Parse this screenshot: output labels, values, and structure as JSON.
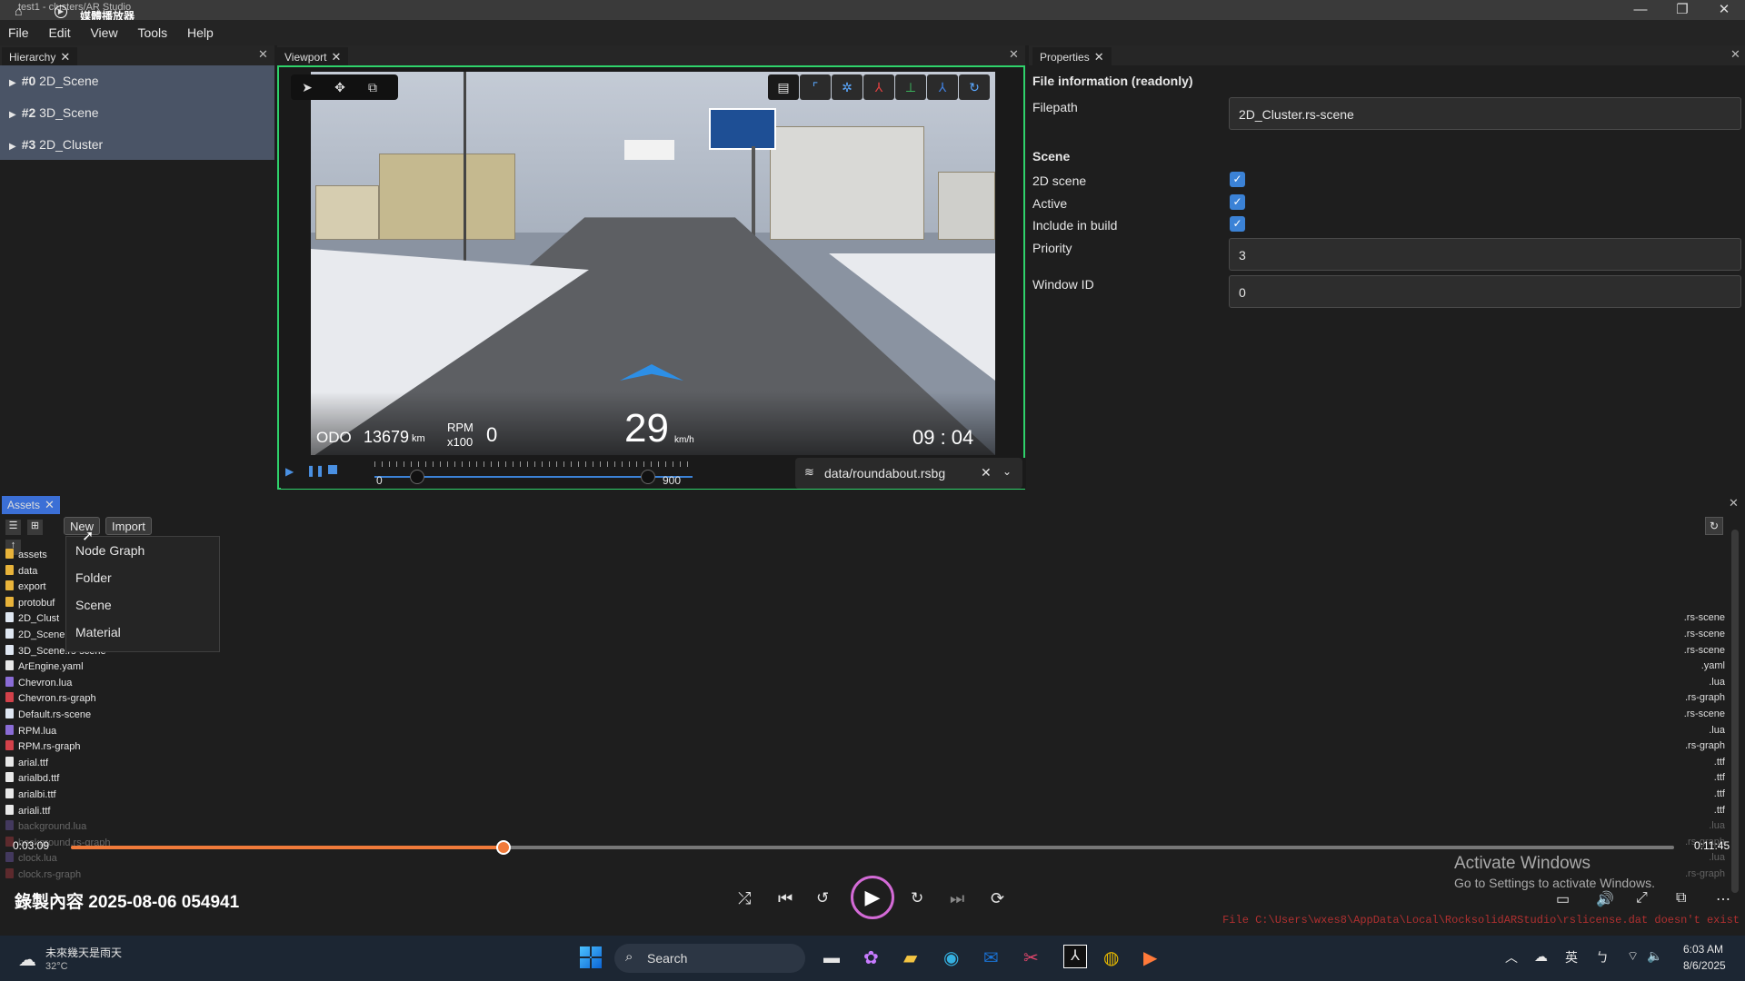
{
  "titlebar": {
    "app_title": "test1 - clusters/AR Studio",
    "overlay_title": "媒體播放器",
    "minimize": "—",
    "restore": "❐",
    "close": "✕"
  },
  "menu": [
    "File",
    "Edit",
    "View",
    "Tools",
    "Help"
  ],
  "hierarchy": {
    "tab": "Hierarchy",
    "items": [
      {
        "id": "#0",
        "name": "2D_Scene"
      },
      {
        "id": "#2",
        "name": "3D_Scene"
      },
      {
        "id": "#3",
        "name": "2D_Cluster"
      }
    ]
  },
  "viewport": {
    "tab": "Viewport",
    "odo_label": "ODO",
    "odo_value": "13679",
    "odo_unit": "km",
    "rpm_label": "RPM",
    "rpm_scale": "x100",
    "rpm_value": "0",
    "speed": "29",
    "speed_unit": "km/h",
    "clock": "09 : 04",
    "timeline_start": "0",
    "timeline_end": "900",
    "file": "data/roundabout.rsbg",
    "timeline_progress": 0.02
  },
  "properties": {
    "tab": "Properties",
    "section_file": "File information (readonly)",
    "filepath_label": "Filepath",
    "filepath_value": "2D_Cluster.rs-scene",
    "section_scene": "Scene",
    "scene2d_label": "2D scene",
    "active_label": "Active",
    "build_label": "Include in build",
    "priority_label": "Priority",
    "priority_value": "3",
    "window_label": "Window ID",
    "window_value": "0"
  },
  "assets": {
    "tab": "Assets",
    "new_btn": "New",
    "import_btn": "Import",
    "menu": [
      "Node Graph",
      "Folder",
      "Scene",
      "Material"
    ],
    "files": [
      {
        "name": "assets",
        "ext": "",
        "kind": "folder"
      },
      {
        "name": "data",
        "ext": "",
        "kind": "folder"
      },
      {
        "name": "export",
        "ext": "",
        "kind": "folder"
      },
      {
        "name": "protobuf",
        "ext": "",
        "kind": "folder"
      },
      {
        "name": "2D_Clust",
        "ext": ".rs-scene",
        "kind": "scene"
      },
      {
        "name": "2D_Scene",
        "ext": ".rs-scene",
        "kind": "scene"
      },
      {
        "name": "3D_Scene.rs-scene",
        "ext": ".rs-scene",
        "kind": "scene"
      },
      {
        "name": "ArEngine.yaml",
        "ext": ".yaml",
        "kind": "file"
      },
      {
        "name": "Chevron.lua",
        "ext": ".lua",
        "kind": "lua"
      },
      {
        "name": "Chevron.rs-graph",
        "ext": ".rs-graph",
        "kind": "graph"
      },
      {
        "name": "Default.rs-scene",
        "ext": ".rs-scene",
        "kind": "scene"
      },
      {
        "name": "RPM.lua",
        "ext": ".lua",
        "kind": "lua"
      },
      {
        "name": "RPM.rs-graph",
        "ext": ".rs-graph",
        "kind": "graph"
      },
      {
        "name": "arial.ttf",
        "ext": ".ttf",
        "kind": "file"
      },
      {
        "name": "arialbd.ttf",
        "ext": ".ttf",
        "kind": "file"
      },
      {
        "name": "arialbi.ttf",
        "ext": ".ttf",
        "kind": "file"
      },
      {
        "name": "ariali.ttf",
        "ext": ".ttf",
        "kind": "file"
      },
      {
        "name": "background.lua",
        "ext": ".lua",
        "kind": "lua"
      },
      {
        "name": "background.rs-graph",
        "ext": ".rs-graph",
        "kind": "graph"
      },
      {
        "name": "clock.lua",
        "ext": ".lua",
        "kind": "lua"
      },
      {
        "name": "clock.rs-graph",
        "ext": ".rs-graph",
        "kind": "graph"
      }
    ]
  },
  "player": {
    "elapsed": "0:03:09",
    "total": "0:11:45",
    "progress": 0.27,
    "recording_title": "錄製內容 2025-08-06 054941",
    "activate_title": "Activate Windows",
    "activate_sub": "Go to Settings to activate Windows.",
    "license_msg": "File C:\\Users\\wxes8\\AppData\\Local\\RocksolidARStudio\\rslicense.dat doesn't exist"
  },
  "taskbar": {
    "weather_text": "未來幾天是雨天",
    "temp": "32°C",
    "search_placeholder": "Search",
    "lang": "英",
    "time": "6:03 AM",
    "date": "8/6/2025"
  },
  "colors": {
    "accent_green": "#2fd26b",
    "accent_blue": "#3b82d6",
    "progress_orange": "#f07a3a",
    "hierarchy_bg": "#4a5466"
  }
}
